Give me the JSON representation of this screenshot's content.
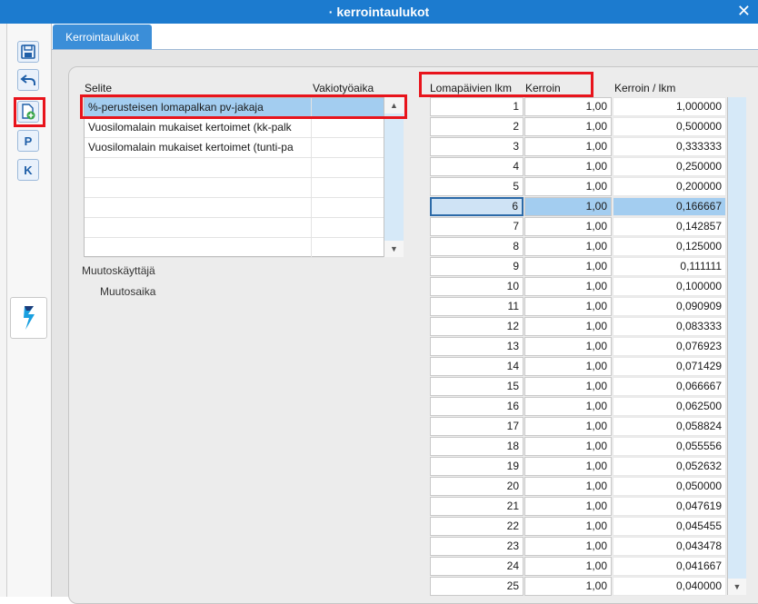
{
  "window": {
    "title": "· kerrointaulukot",
    "close_label": "✕"
  },
  "toolbar": {
    "buttons": [
      {
        "name": "save-button",
        "icon": "save-icon"
      },
      {
        "name": "back-button",
        "icon": "undo-arrow-icon"
      },
      {
        "name": "new-document-button",
        "icon": "new-document-icon"
      },
      {
        "name": "p-button",
        "label": "P"
      },
      {
        "name": "k-button",
        "label": "K"
      }
    ],
    "logo_icon": "app-logo-icon"
  },
  "tabs": [
    {
      "label": "Kerrointaulukot"
    }
  ],
  "left_table": {
    "headers": {
      "selite": "Selite",
      "vakiotyoaika": "Vakiotyöaika"
    },
    "rows": [
      {
        "selite": "%-perusteisen lomapalkan pv-jakaja",
        "vakiotyoaika": ""
      },
      {
        "selite": "Vuosilomalain mukaiset kertoimet (kk-palk",
        "vakiotyoaika": ""
      },
      {
        "selite": "Vuosilomalain mukaiset kertoimet (tunti-pa",
        "vakiotyoaika": ""
      },
      {
        "selite": "",
        "vakiotyoaika": ""
      },
      {
        "selite": "",
        "vakiotyoaika": ""
      },
      {
        "selite": "",
        "vakiotyoaika": ""
      },
      {
        "selite": "",
        "vakiotyoaika": ""
      },
      {
        "selite": "",
        "vakiotyoaika": ""
      }
    ],
    "selected_index": 0
  },
  "meta": {
    "muutoskayttaja_label": "Muutoskäyttäjä",
    "muutosaika_label": "Muutosaika"
  },
  "right_table": {
    "headers": {
      "lomapaivien": "Lomapäivien lkm",
      "kerroin": "Kerroin",
      "kerroin_per_lkm": "Kerroin / lkm"
    },
    "selected_index": 5,
    "rows": [
      {
        "lkm": "1",
        "kerroin": "1,00",
        "kerroin_lkm": "1,000000"
      },
      {
        "lkm": "2",
        "kerroin": "1,00",
        "kerroin_lkm": "0,500000"
      },
      {
        "lkm": "3",
        "kerroin": "1,00",
        "kerroin_lkm": "0,333333"
      },
      {
        "lkm": "4",
        "kerroin": "1,00",
        "kerroin_lkm": "0,250000"
      },
      {
        "lkm": "5",
        "kerroin": "1,00",
        "kerroin_lkm": "0,200000"
      },
      {
        "lkm": "6",
        "kerroin": "1,00",
        "kerroin_lkm": "0,166667"
      },
      {
        "lkm": "7",
        "kerroin": "1,00",
        "kerroin_lkm": "0,142857"
      },
      {
        "lkm": "8",
        "kerroin": "1,00",
        "kerroin_lkm": "0,125000"
      },
      {
        "lkm": "9",
        "kerroin": "1,00",
        "kerroin_lkm": "0,111111"
      },
      {
        "lkm": "10",
        "kerroin": "1,00",
        "kerroin_lkm": "0,100000"
      },
      {
        "lkm": "11",
        "kerroin": "1,00",
        "kerroin_lkm": "0,090909"
      },
      {
        "lkm": "12",
        "kerroin": "1,00",
        "kerroin_lkm": "0,083333"
      },
      {
        "lkm": "13",
        "kerroin": "1,00",
        "kerroin_lkm": "0,076923"
      },
      {
        "lkm": "14",
        "kerroin": "1,00",
        "kerroin_lkm": "0,071429"
      },
      {
        "lkm": "15",
        "kerroin": "1,00",
        "kerroin_lkm": "0,066667"
      },
      {
        "lkm": "16",
        "kerroin": "1,00",
        "kerroin_lkm": "0,062500"
      },
      {
        "lkm": "17",
        "kerroin": "1,00",
        "kerroin_lkm": "0,058824"
      },
      {
        "lkm": "18",
        "kerroin": "1,00",
        "kerroin_lkm": "0,055556"
      },
      {
        "lkm": "19",
        "kerroin": "1,00",
        "kerroin_lkm": "0,052632"
      },
      {
        "lkm": "20",
        "kerroin": "1,00",
        "kerroin_lkm": "0,050000"
      },
      {
        "lkm": "21",
        "kerroin": "1,00",
        "kerroin_lkm": "0,047619"
      },
      {
        "lkm": "22",
        "kerroin": "1,00",
        "kerroin_lkm": "0,045455"
      },
      {
        "lkm": "23",
        "kerroin": "1,00",
        "kerroin_lkm": "0,043478"
      },
      {
        "lkm": "24",
        "kerroin": "1,00",
        "kerroin_lkm": "0,041667"
      },
      {
        "lkm": "25",
        "kerroin": "1,00",
        "kerroin_lkm": "0,040000"
      }
    ]
  },
  "colors": {
    "titlebar": "#1c7bcf",
    "tab": "#3b8ed8",
    "selection": "#a3cdf0",
    "highlight_box": "#e8141c"
  }
}
